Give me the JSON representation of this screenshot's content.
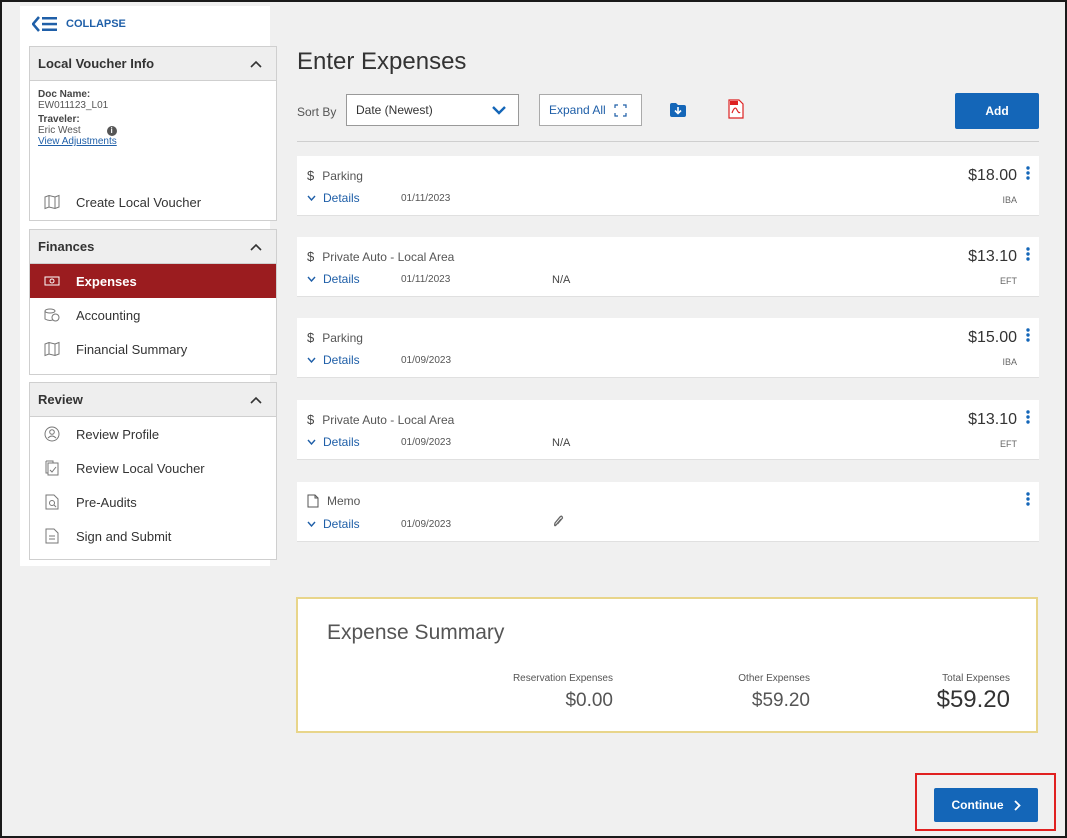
{
  "sidebar": {
    "collapse_label": "COLLAPSE",
    "voucher_info": {
      "title": "Local Voucher Info",
      "doc_name_label": "Doc Name:",
      "doc_name": "EW011123_L01",
      "traveler_label": "Traveler:",
      "traveler": "Eric West",
      "view_adjustments": "View Adjustments",
      "create_local_voucher": "Create Local Voucher"
    },
    "finances": {
      "title": "Finances",
      "items": [
        {
          "label": "Expenses",
          "icon": "money-icon",
          "active": true
        },
        {
          "label": "Accounting",
          "icon": "coins-icon"
        },
        {
          "label": "Financial Summary",
          "icon": "map-icon"
        }
      ]
    },
    "review": {
      "title": "Review",
      "items": [
        {
          "label": "Review Profile",
          "icon": "profile-icon"
        },
        {
          "label": "Review Local Voucher",
          "icon": "document-check-icon"
        },
        {
          "label": "Pre-Audits",
          "icon": "document-search-icon"
        },
        {
          "label": "Sign and Submit",
          "icon": "document-sign-icon"
        }
      ]
    }
  },
  "main": {
    "title": "Enter Expenses",
    "sort_by_label": "Sort By",
    "sort_value": "Date (Newest)",
    "expand_all": "Expand All",
    "add_label": "Add",
    "details_label": "Details",
    "expenses": [
      {
        "symbol": "$",
        "description": "Parking",
        "date": "01/11/2023",
        "extra": "",
        "amount": "$18.00",
        "method": "IBA"
      },
      {
        "symbol": "$",
        "description": "Private Auto - Local Area",
        "date": "01/11/2023",
        "extra": "N/A",
        "amount": "$13.10",
        "method": "EFT"
      },
      {
        "symbol": "$",
        "description": "Parking",
        "date": "01/09/2023",
        "extra": "",
        "amount": "$15.00",
        "method": "IBA"
      },
      {
        "symbol": "$",
        "description": "Private Auto - Local Area",
        "date": "01/09/2023",
        "extra": "N/A",
        "amount": "$13.10",
        "method": "EFT"
      },
      {
        "symbol": "memo-icon",
        "description": "Memo",
        "date": "01/09/2023",
        "extra": "attachment-icon",
        "amount": "",
        "method": ""
      }
    ],
    "summary": {
      "title": "Expense Summary",
      "reservation_label": "Reservation Expenses",
      "reservation_value": "$0.00",
      "other_label": "Other Expenses",
      "other_value": "$59.20",
      "total_label": "Total Expenses",
      "total_value": "$59.20"
    },
    "continue_label": "Continue"
  },
  "colors": {
    "accent_blue": "#1466b8",
    "active_red": "#9b1c1f",
    "highlight_red": "#e02020",
    "summary_border": "#e8d58a"
  }
}
